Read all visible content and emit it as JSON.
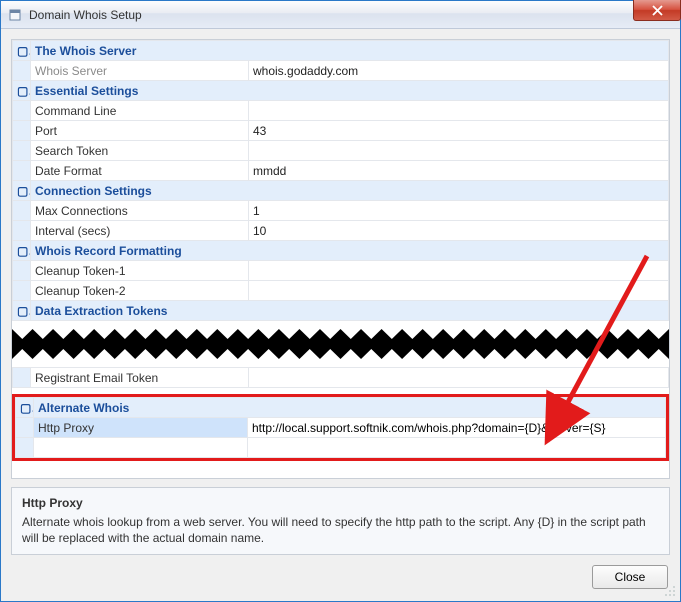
{
  "window": {
    "title": "Domain Whois Setup",
    "close_btn": "Close"
  },
  "annotations": {
    "highlight_color": "#e21b1b",
    "arrow_color": "#e21b1b"
  },
  "sections": {
    "whois_server": {
      "title": "The Whois Server",
      "rows": {
        "server": {
          "label": "Whois Server",
          "value": "whois.godaddy.com"
        }
      }
    },
    "essential": {
      "title": "Essential Settings",
      "rows": {
        "cmd": {
          "label": "Command Line",
          "value": ""
        },
        "port": {
          "label": "Port",
          "value": "43"
        },
        "stoken": {
          "label": "Search Token",
          "value": ""
        },
        "datefmt": {
          "label": "Date Format",
          "value": "mmdd"
        }
      }
    },
    "connection": {
      "title": "Connection Settings",
      "rows": {
        "maxconn": {
          "label": "Max Connections",
          "value": "1"
        },
        "interval": {
          "label": "Interval (secs)",
          "value": "10"
        }
      }
    },
    "formatting": {
      "title": "Whois Record Formatting",
      "rows": {
        "ct1": {
          "label": "Cleanup Token-1",
          "value": ""
        },
        "ct2": {
          "label": "Cleanup Token-2",
          "value": ""
        }
      }
    },
    "extraction": {
      "title": "Data Extraction Tokens",
      "rows": {
        "reg_email": {
          "label": "Registrant Email Token",
          "value": ""
        }
      }
    },
    "alternate": {
      "title": "Alternate Whois",
      "rows": {
        "http_proxy": {
          "label": "Http Proxy",
          "value": "http://local.support.softnik.com/whois.php?domain={D}&server={S}"
        }
      }
    }
  },
  "help": {
    "title": "Http Proxy",
    "body": "Alternate whois lookup from a web server. You will need to specify the http path to the script. Any {D} in the script path will be replaced with the actual domain name."
  },
  "buttons": {
    "close": "Close"
  }
}
